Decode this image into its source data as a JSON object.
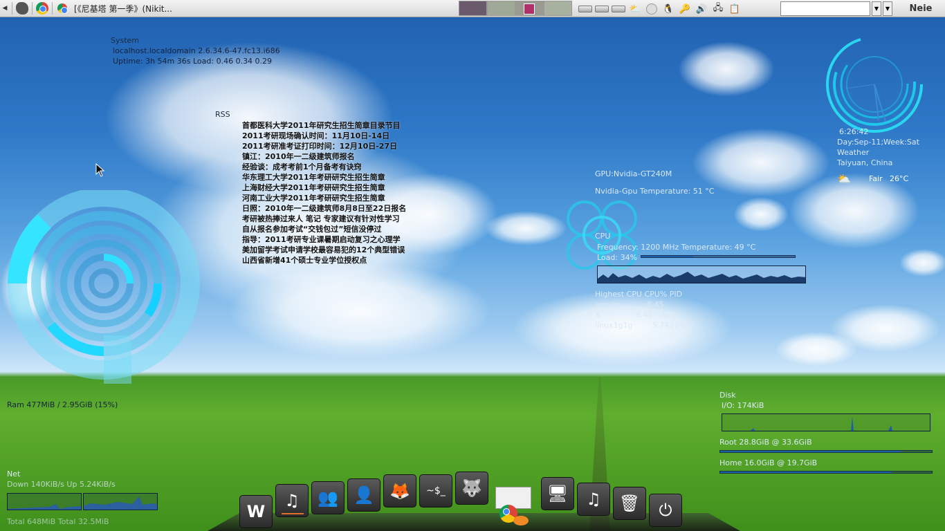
{
  "top_panel": {
    "window_title": "[《尼基塔 第一季》(Nikit...",
    "clock": "Neie",
    "search_placeholder": ""
  },
  "system": {
    "header": "System",
    "hostname": "localhost.localdomain 2.6.34.6-47.fc13.i686",
    "uptime": "Uptime: 3h 54m 36s  Load: 0.46 0.34 0.29"
  },
  "rss": {
    "header": "RSS",
    "items": [
      "首都医科大学2011年研究生招生简章目录节目",
      "2011考研现场确认时间：11月10日-14日",
      "2011考研准考证打印时间：12月10日-27日",
      "镇江：2010年一二级建筑师报名",
      "经验谈：成考考前1个月备考有诀窍",
      "华东理工大学2011年考研研究生招生简章",
      "上海财经大学2011年考研研究生招生简章",
      "河南工业大学2011年考研研究生招生简章",
      "日照：2010年一二级建筑师8月8日至22日报名",
      "考研被热捧过来人 笔记 专家建议有针对性学习",
      "自从报名参加考试“交钱包过”短信没停过",
      "指导：2011考研专业课暑期启动复习之心理学",
      "美加留学考试申请学校最容易犯的12个典型错误",
      "山西省新增41个硕士专业学位授权点"
    ]
  },
  "clock_widget": {
    "time": "6:26:42",
    "date": "Day:Sep-11;Week:Sat",
    "weather_label": "Weather",
    "location": "Taiyuan, China",
    "condition": "Fair",
    "temperature": "26°C"
  },
  "gpu": {
    "name": "GPU:Nvidia-GT240M",
    "temp": "Nvidia-Gpu Temperature: 51 °C"
  },
  "cpu": {
    "header": "CPU",
    "freq_temp": "Frequency: 1200 MHz  Temperature: 49 °C",
    "load_label": "Load: 34%",
    "load_pct": 0.34,
    "table_header": "Highest CPU      CPU%  PID",
    "processes": [
      {
        "name": "amule",
        "cpu": "8.45",
        "pid": ""
      },
      {
        "name": "X",
        "cpu": "8.45",
        "pid": "1676"
      },
      {
        "name": "linux1g1g",
        "cpu": "5.74",
        "pid": "22484"
      }
    ]
  },
  "ram": {
    "label": "Ram  477MiB / 2.95GiB (15%)"
  },
  "net": {
    "header": "Net",
    "speeds": "Down 140KiB/s  Up 5.24KiB/s",
    "totals": "Total 648MiB   Total 32.5MiB"
  },
  "disk": {
    "header": "Disk",
    "io": "I/O: 174KiB",
    "root": "Root  28.8GiB  @ 33.6GiB",
    "root_pct": 0.857,
    "home": "Home  16.0GiB  @ 19.7GiB",
    "home_pct": 0.812
  },
  "dock": {
    "items": [
      {
        "name": "writer-icon",
        "glyph": "W"
      },
      {
        "name": "music-player-icon",
        "glyph": "♫"
      },
      {
        "name": "contacts-icon",
        "glyph": "👥"
      },
      {
        "name": "users-icon",
        "glyph": "👤"
      },
      {
        "name": "firefox-icon",
        "glyph": "🦊"
      },
      {
        "name": "terminal-icon",
        "glyph": "~$_"
      },
      {
        "name": "gimp-icon",
        "glyph": "🐺"
      },
      {
        "name": "chrome-icon",
        "glyph": ""
      },
      {
        "name": "desktop-icon",
        "glyph": "🖥"
      },
      {
        "name": "music-icon",
        "glyph": "♫"
      },
      {
        "name": "trash-icon",
        "glyph": "🗑"
      },
      {
        "name": "power-icon",
        "glyph": "⏻"
      }
    ]
  }
}
